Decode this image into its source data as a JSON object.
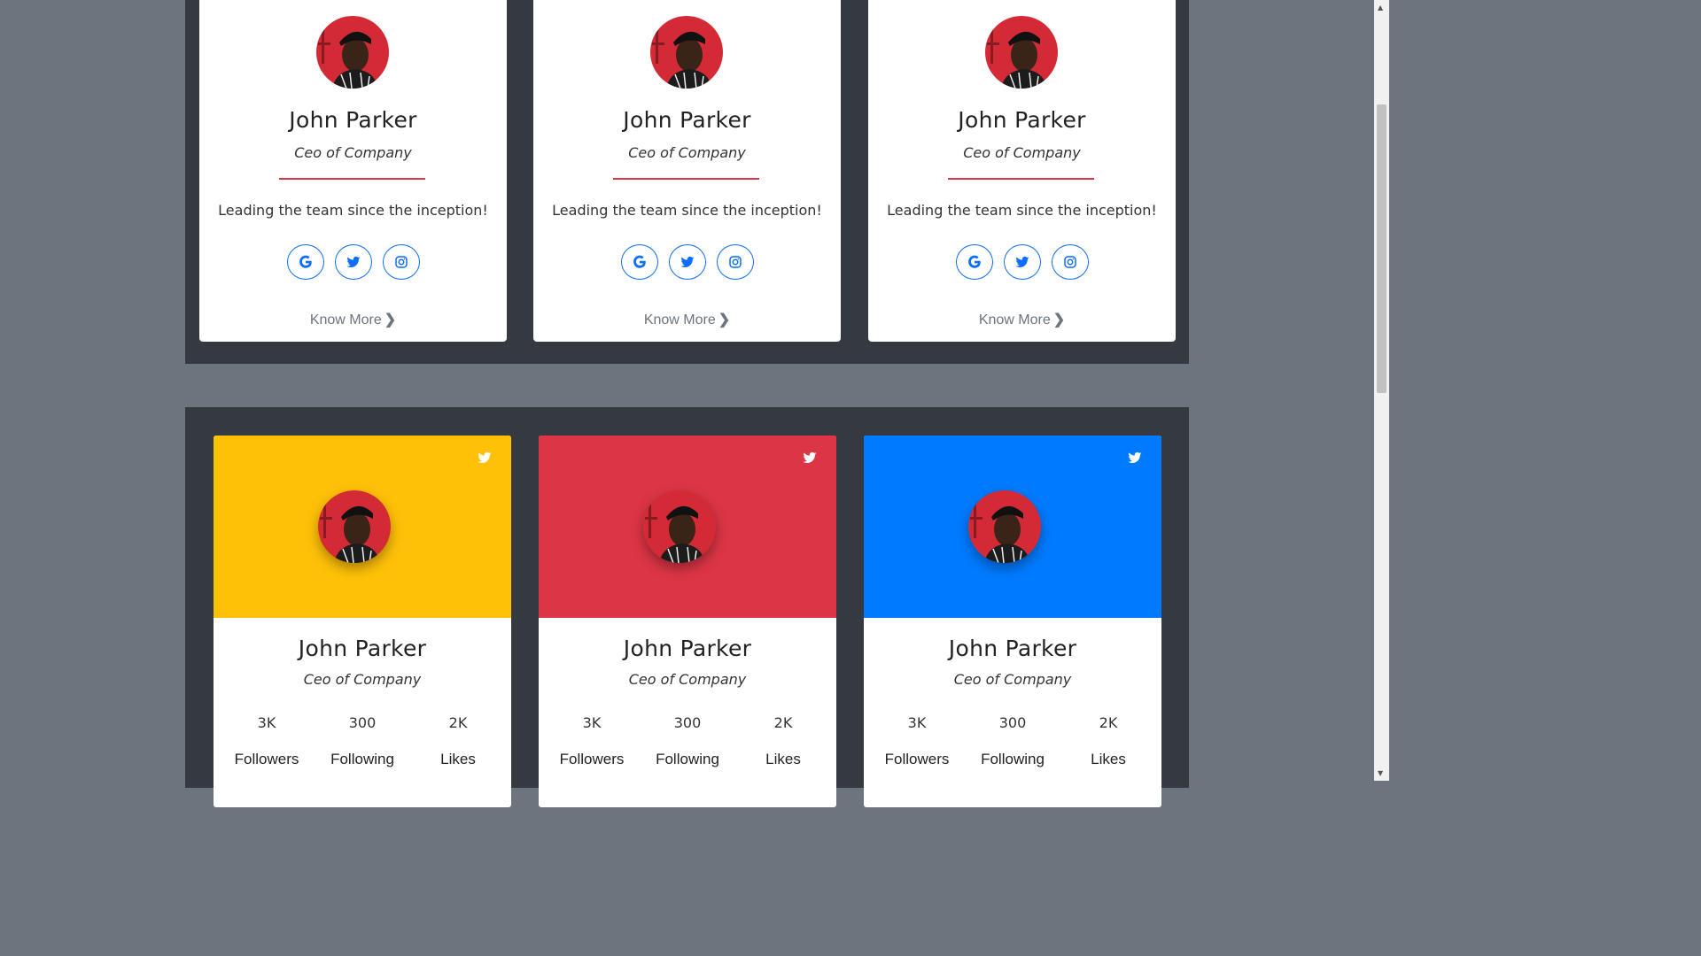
{
  "profile_cards": [
    {
      "name": "John Parker",
      "role": "Ceo of Company",
      "description": "Leading the team since the inception!",
      "socials": [
        "google-icon",
        "twitter-icon",
        "instagram-icon"
      ],
      "link_label": "Know More"
    },
    {
      "name": "John Parker",
      "role": "Ceo of Company",
      "description": "Leading the team since the inception!",
      "socials": [
        "google-icon",
        "twitter-icon",
        "instagram-icon"
      ],
      "link_label": "Know More"
    },
    {
      "name": "John Parker",
      "role": "Ceo of Company",
      "description": "Leading the team since the inception!",
      "socials": [
        "google-icon",
        "twitter-icon",
        "instagram-icon"
      ],
      "link_label": "Know More"
    }
  ],
  "colored_cards": [
    {
      "header_color": "#ffc107",
      "name": "John Parker",
      "role": "Ceo of Company",
      "stats": [
        {
          "value": "3K",
          "label": "Followers"
        },
        {
          "value": "300",
          "label": "Following"
        },
        {
          "value": "2K",
          "label": "Likes"
        }
      ]
    },
    {
      "header_color": "#dc3545",
      "name": "John Parker",
      "role": "Ceo of Company",
      "stats": [
        {
          "value": "3K",
          "label": "Followers"
        },
        {
          "value": "300",
          "label": "Following"
        },
        {
          "value": "2K",
          "label": "Likes"
        }
      ]
    },
    {
      "header_color": "#007bff",
      "name": "John Parker",
      "role": "Ceo of Company",
      "stats": [
        {
          "value": "3K",
          "label": "Followers"
        },
        {
          "value": "300",
          "label": "Following"
        },
        {
          "value": "2K",
          "label": "Likes"
        }
      ]
    }
  ],
  "colors": {
    "page_background": "#6c757d",
    "section_background": "#343a40",
    "accent_red": "#dc3545",
    "social_blue": "#0d6efd"
  }
}
